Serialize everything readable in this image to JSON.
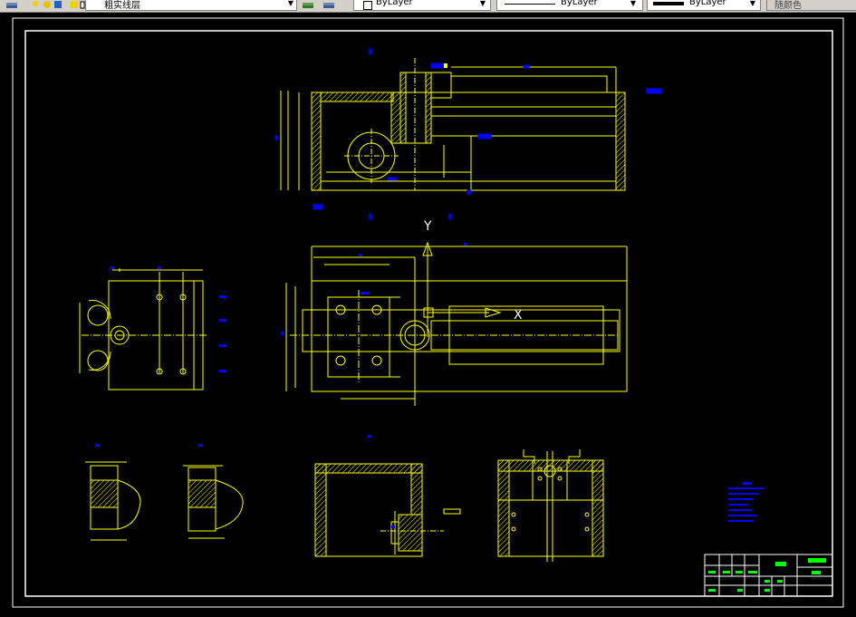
{
  "toolbar": {
    "layer_name": "粗实线层",
    "color_value": "ByLayer",
    "linetype_value": "ByLayer",
    "lineweight_value": "ByLayer",
    "plotstyle_value": "随颜色"
  },
  "drawing": {
    "axis_y_label": "Y",
    "axis_x_label": "X"
  },
  "colors": {
    "background": "#000000",
    "geometry": "#ffff00",
    "dimension": "#0000ff",
    "border": "#ffffff",
    "titleblock_accent": "#00ff00"
  }
}
